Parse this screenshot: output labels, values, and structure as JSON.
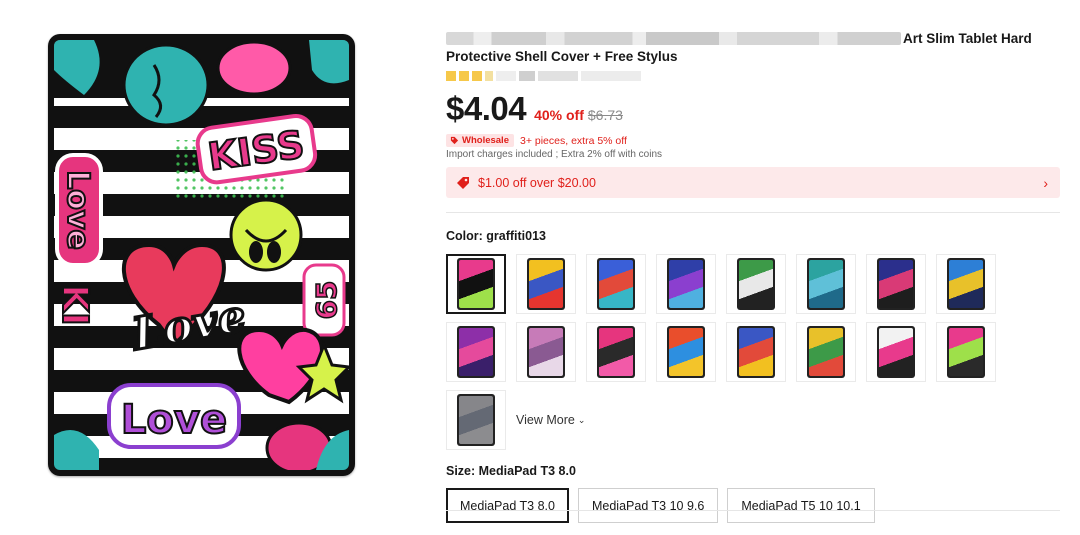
{
  "product": {
    "title_visible": "Art Slim Tablet Hard Protective Shell Cover + Free Stylus"
  },
  "price": {
    "current": "$4.04",
    "discount": "40% off",
    "original": "$6.73"
  },
  "wholesale": {
    "badge": "Wholesale",
    "text": "3+ pieces, extra 5% off"
  },
  "import_note": "Import charges included ; Extra 2% off with coins",
  "coupon": {
    "text": "$1.00 off over $20.00",
    "icon": "tag-icon"
  },
  "color": {
    "label": "Color: graffiti013",
    "view_more": "View More",
    "swatches": [
      {
        "c1": "#e83a8c",
        "c2": "#111",
        "c3": "#9ee04a",
        "selected": true
      },
      {
        "c1": "#f2c020",
        "c2": "#3a57c4",
        "c3": "#e6352f",
        "selected": false
      },
      {
        "c1": "#3a5fd8",
        "c2": "#e24a3a",
        "c3": "#37b6c6",
        "selected": false
      },
      {
        "c1": "#2f3fa8",
        "c2": "#8b3fcf",
        "c3": "#4fb0e0",
        "selected": false
      },
      {
        "c1": "#3d9a48",
        "c2": "#e8e8e8",
        "c3": "#222",
        "selected": false
      },
      {
        "c1": "#2ca3a0",
        "c2": "#5fc0d8",
        "c3": "#1f6a8a",
        "selected": false
      },
      {
        "c1": "#2b2f8c",
        "c2": "#d93a76",
        "c3": "#1e1e1e",
        "selected": false
      },
      {
        "c1": "#2d7fd6",
        "c2": "#e8c12a",
        "c3": "#1f2a5a",
        "selected": false
      },
      {
        "c1": "#8d2fa8",
        "c2": "#e54a9c",
        "c3": "#3a1f6a",
        "selected": false
      },
      {
        "c1": "#c77bb8",
        "c2": "#8a5a92",
        "c3": "#e8d8e8",
        "selected": false
      },
      {
        "c1": "#e6357e",
        "c2": "#2a2a2a",
        "c3": "#f25aa8",
        "selected": false
      },
      {
        "c1": "#e94e2c",
        "c2": "#2d8fe0",
        "c3": "#f3c42a",
        "selected": false
      },
      {
        "c1": "#3a57c4",
        "c2": "#e24a3a",
        "c3": "#f2c020",
        "selected": false
      },
      {
        "c1": "#e8c12a",
        "c2": "#3d9a48",
        "c3": "#e24a3a",
        "selected": false
      },
      {
        "c1": "#f2f2f2",
        "c2": "#e83a8c",
        "c3": "#222",
        "selected": false
      },
      {
        "c1": "#e83a8c",
        "c2": "#9ee04a",
        "c3": "#2a2a2a",
        "selected": false
      },
      {
        "c1": "#d8d8e0",
        "c2": "#9aa3b8",
        "c3": "#e2e2e8",
        "selected": false
      }
    ]
  },
  "size": {
    "label": "Size: MediaPad T3 8.0",
    "options": [
      "MediaPad T3 8.0",
      "MediaPad T3 10 9.6",
      "MediaPad T5 10 10.1"
    ],
    "selected_index": 0
  },
  "image_art_text": [
    "KISS",
    "LOVE",
    "Love",
    "KI",
    "65"
  ],
  "colors": {
    "accent_red": "#e0201b",
    "coupon_bg": "#fde9ea",
    "text": "#191919"
  }
}
